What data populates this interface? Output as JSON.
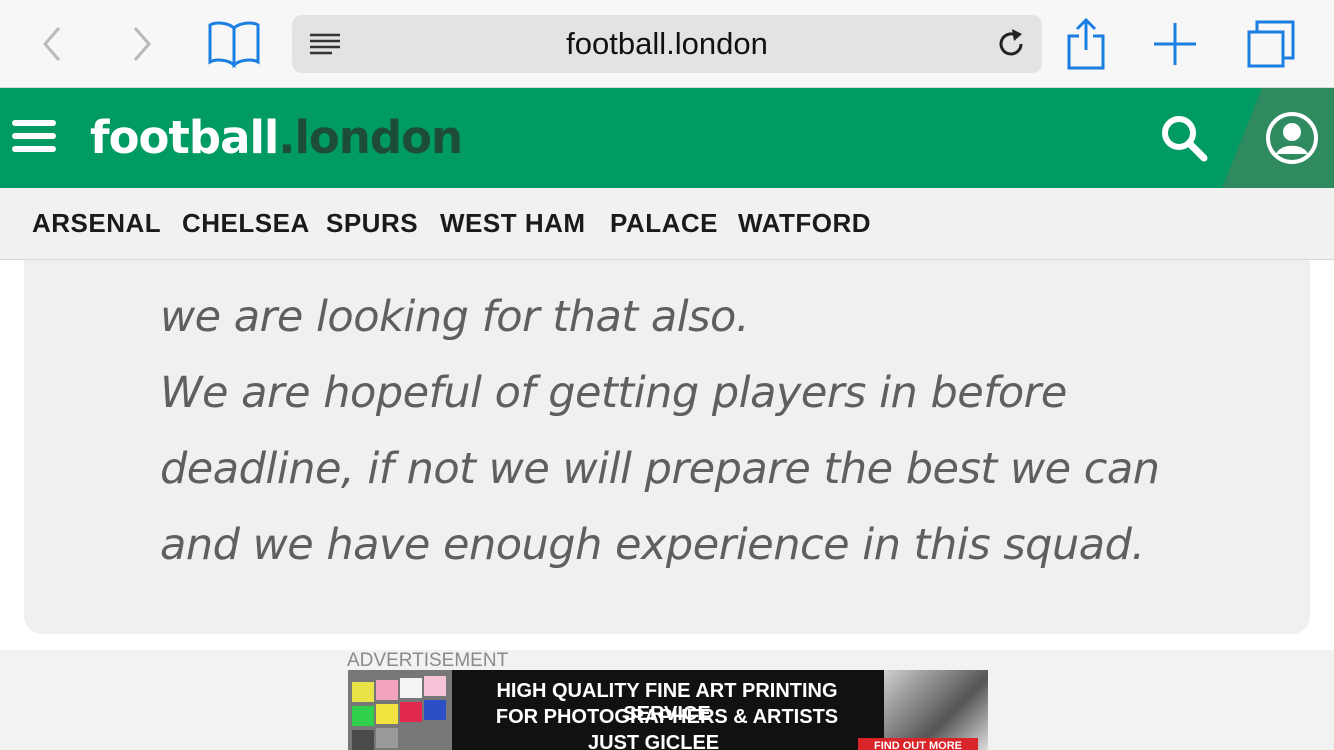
{
  "browser": {
    "url": "football.london",
    "icons": {
      "back": "chevron-left-icon",
      "forward": "chevron-right-icon",
      "bookmarks": "book-icon",
      "reader": "reader-lines-icon",
      "reload": "reload-icon",
      "share": "share-icon",
      "new_tab": "plus-icon",
      "tabs": "tabs-icon"
    },
    "tint": "#1a7ee3"
  },
  "site": {
    "logo_part1": "football",
    "logo_part2": ".london",
    "brand_color": "#009b62",
    "icons": {
      "menu": "hamburger-icon",
      "search": "search-icon",
      "account": "account-icon"
    }
  },
  "club_nav": {
    "items": [
      {
        "label": "ARSENAL"
      },
      {
        "label": "CHELSEA"
      },
      {
        "label": "SPURS"
      },
      {
        "label": "WEST HAM"
      },
      {
        "label": "PALACE"
      },
      {
        "label": "WATFORD"
      }
    ]
  },
  "quote": {
    "lines": [
      "we are looking for that also.",
      "We are hopeful of getting players in before",
      "deadline, if not we will prepare the best we can",
      "and we have enough experience in this squad."
    ]
  },
  "ad": {
    "label": "ADVERTISEMENT",
    "headline1": "HIGH QUALITY FINE ART PRINTING SERVICE",
    "headline2": "FOR PHOTOGRAPHERS & ARTISTS",
    "brand": "JUST GICLEE",
    "cta": "FIND OUT MORE"
  }
}
